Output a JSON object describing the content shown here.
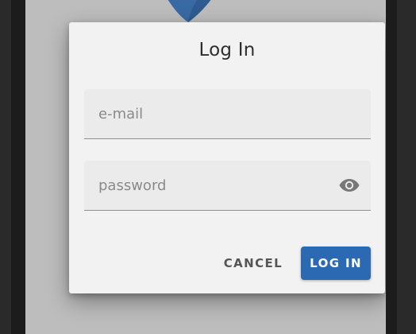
{
  "dialog": {
    "title": "Log In",
    "email": {
      "value": "",
      "placeholder": "e-mail"
    },
    "password": {
      "value": "",
      "placeholder": "password",
      "visibility_icon": "eye-icon"
    },
    "actions": {
      "cancel_label": "CANCEL",
      "login_label": "LOG IN"
    }
  },
  "colors": {
    "accent": "#2b6ab3",
    "dialog_background": "#f2f2f2",
    "field_background": "#ebebeb",
    "scrim": "#bdbdbd",
    "logo": "#3a6aa3"
  }
}
